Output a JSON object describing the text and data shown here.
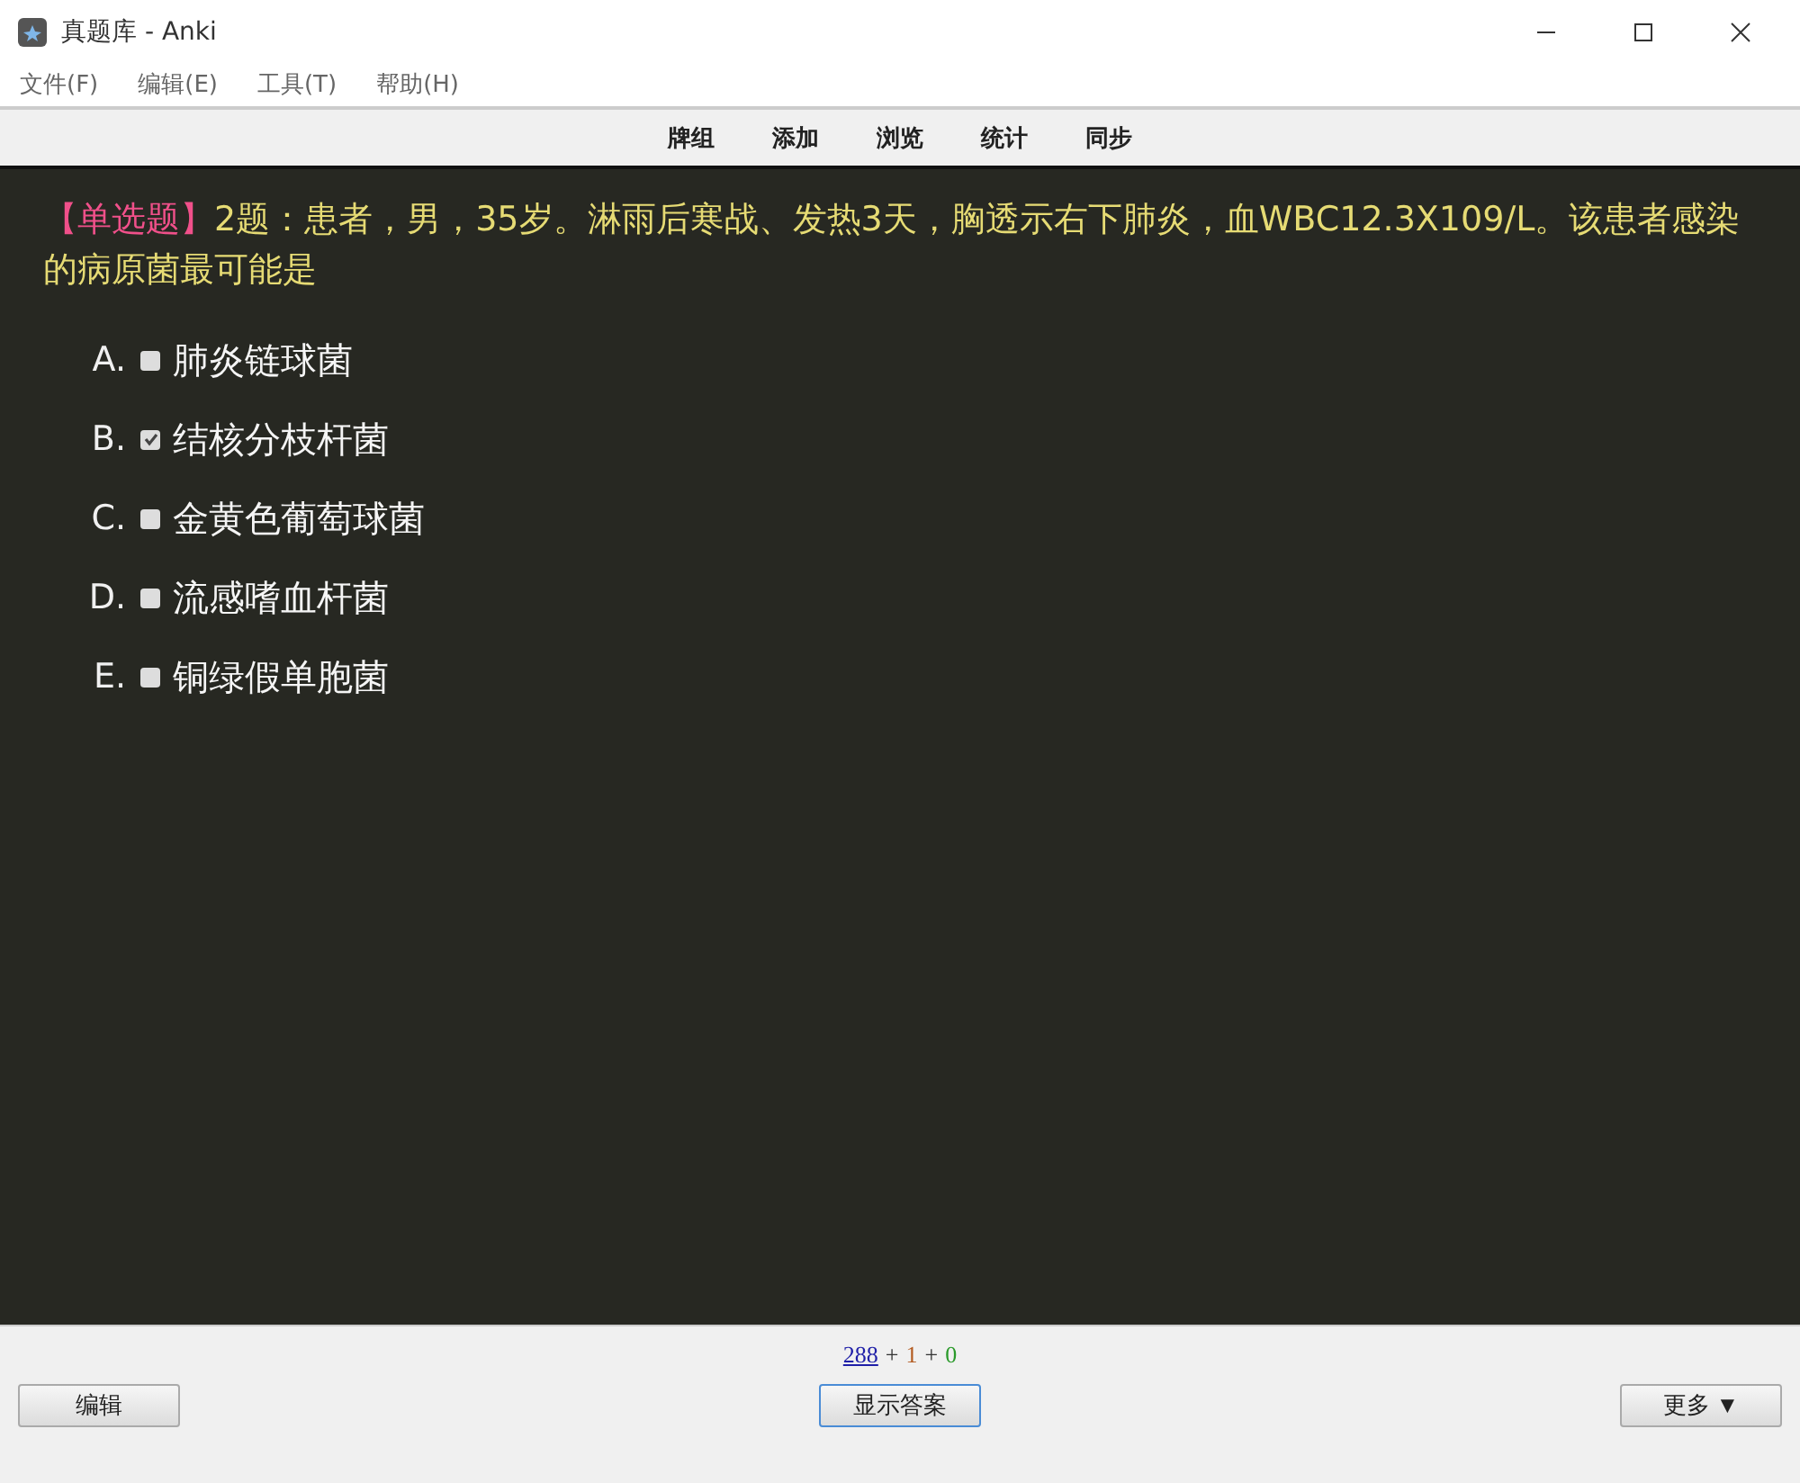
{
  "window": {
    "title": "真题库 - Anki"
  },
  "menu": [
    "文件(F)",
    "编辑(E)",
    "工具(T)",
    "帮助(H)"
  ],
  "toolbar": [
    "牌组",
    "添加",
    "浏览",
    "统计",
    "同步"
  ],
  "question": {
    "tag": "【单选题】",
    "text": "2题：患者，男，35岁。淋雨后寒战、发热3天，胸透示右下肺炎，血WBC12.3X109/L。该患者感染的病原菌最可能是"
  },
  "options": [
    {
      "letter": "A.",
      "text": "肺炎链球菌",
      "checked": false
    },
    {
      "letter": "B.",
      "text": "结核分枝杆菌",
      "checked": true
    },
    {
      "letter": "C.",
      "text": "金黄色葡萄球菌",
      "checked": false
    },
    {
      "letter": "D.",
      "text": "流感嗜血杆菌",
      "checked": false
    },
    {
      "letter": "E.",
      "text": "铜绿假单胞菌",
      "checked": false
    }
  ],
  "counts": [
    {
      "kind": "link",
      "text": "288",
      "color": "#1f1fa8"
    },
    {
      "kind": "sep",
      "text": "+"
    },
    {
      "kind": "num",
      "text": "1",
      "color": "#b35a1f"
    },
    {
      "kind": "sep",
      "text": "+"
    },
    {
      "kind": "num",
      "text": "0",
      "color": "#2a9a2a"
    }
  ],
  "buttons": {
    "edit": "编辑",
    "show_answer": "显示答案",
    "more": "更多 ▼"
  }
}
